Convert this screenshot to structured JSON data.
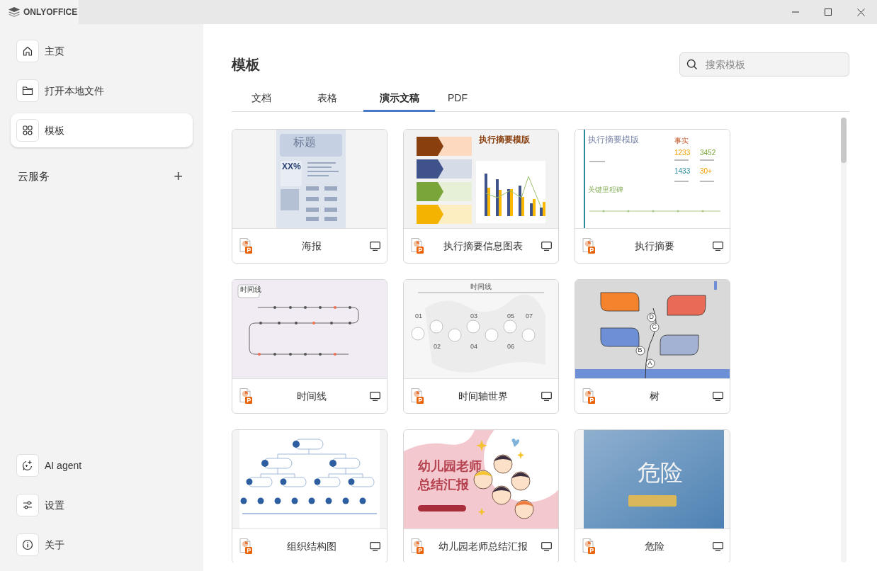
{
  "app": {
    "logo_text": "ONLYOFFICE"
  },
  "sidebar": {
    "items": [
      {
        "label": "主页",
        "selected": false
      },
      {
        "label": "打开本地文件",
        "selected": false
      },
      {
        "label": "模板",
        "selected": true
      }
    ],
    "cloud": {
      "label": "云服务",
      "add": "+"
    },
    "bottom_items": [
      {
        "label": "AI agent"
      },
      {
        "label": "设置"
      },
      {
        "label": "关于"
      }
    ]
  },
  "main": {
    "title": "模板",
    "search": {
      "placeholder": "搜索模板"
    },
    "tabs": [
      {
        "label": "文档",
        "selected": false
      },
      {
        "label": "表格",
        "selected": false
      },
      {
        "label": "演示文稿",
        "selected": true
      },
      {
        "label": "PDF",
        "selected": false
      }
    ],
    "cards": [
      {
        "name": "海报",
        "kind": "poster",
        "preview_texts": [
          "标题",
          "XX%"
        ]
      },
      {
        "name": "执行摘要信息图表",
        "kind": "exec-infographic",
        "preview_texts": [
          "执行摘要模版"
        ]
      },
      {
        "name": "执行摘要",
        "kind": "exec-summary",
        "preview_texts": [
          "执行摘要模版",
          "事实",
          "1233",
          "3452",
          "1433",
          "30+",
          "关键里程碑"
        ]
      },
      {
        "name": "时间线",
        "kind": "timeline",
        "preview_texts": [
          "时间线"
        ]
      },
      {
        "name": "时间轴世界",
        "kind": "timeline-world",
        "preview_texts": [
          "时间线",
          "01",
          "03",
          "05",
          "07",
          "02",
          "04",
          "06"
        ]
      },
      {
        "name": "树",
        "kind": "tree",
        "preview_texts": [
          "D",
          "C",
          "B",
          "A"
        ]
      },
      {
        "name": "组织结构图",
        "kind": "org-chart"
      },
      {
        "name": "幼儿园老师总结汇报",
        "kind": "kindergarten",
        "preview_texts": [
          "幼儿园老师",
          "总结汇报"
        ]
      },
      {
        "name": "危险",
        "kind": "danger",
        "preview_texts": [
          "危险"
        ]
      }
    ]
  }
}
